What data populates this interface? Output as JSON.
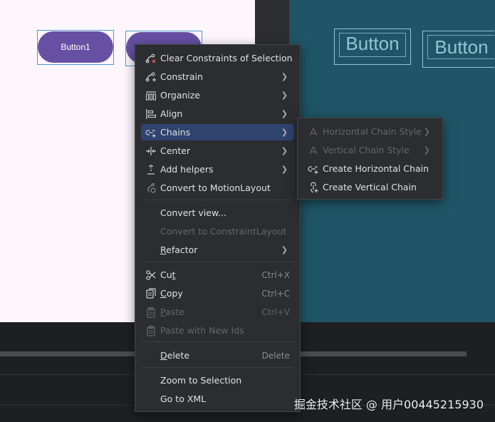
{
  "design": {
    "button1_label": "Button1",
    "blueprint_btn1": "Button",
    "blueprint_btn2": "Button"
  },
  "menu": {
    "items": [
      {
        "label": "Clear Constraints of Selection",
        "icon": "clear-constraints-icon"
      },
      {
        "label": "Constrain",
        "icon": "constrain-icon",
        "submenu": true
      },
      {
        "label": "Organize",
        "icon": "organize-icon",
        "submenu": true
      },
      {
        "label": "Align",
        "icon": "align-icon",
        "submenu": true
      },
      {
        "label": "Chains",
        "icon": "chain-icon",
        "submenu": true,
        "selected": true
      },
      {
        "label": "Center",
        "icon": "center-icon",
        "submenu": true
      },
      {
        "label": "Add helpers",
        "icon": "helpers-icon",
        "submenu": true
      },
      {
        "label": "Convert to MotionLayout",
        "icon": "motionlayout-icon"
      },
      {
        "label": "Convert view...",
        "icon": ""
      },
      {
        "label": "Convert to ConstraintLayout",
        "icon": "",
        "disabled": true
      },
      {
        "label": "Refactor",
        "icon": "",
        "submenu": true,
        "mnemonic": "R"
      },
      {
        "label": "Cut",
        "icon": "scissors-icon",
        "shortcut": "Ctrl+X",
        "mnemonic": "t"
      },
      {
        "label": "Copy",
        "icon": "copy-icon",
        "shortcut": "Ctrl+C",
        "mnemonic": "C"
      },
      {
        "label": "Paste",
        "icon": "paste-icon",
        "shortcut": "Ctrl+V",
        "disabled": true,
        "mnemonic": "P"
      },
      {
        "label": "Paste with New Ids",
        "icon": "paste-icon",
        "disabled": true
      },
      {
        "label": "Delete",
        "icon": "",
        "shortcut": "Delete",
        "mnemonic": "D"
      },
      {
        "label": "Zoom to Selection",
        "icon": ""
      },
      {
        "label": "Go to XML",
        "icon": ""
      }
    ]
  },
  "submenu": {
    "items": [
      {
        "label": "Horizontal Chain Style",
        "icon": "chain-style-icon",
        "submenu": true,
        "disabled": true
      },
      {
        "label": "Vertical Chain Style",
        "icon": "chain-style-icon",
        "submenu": true,
        "disabled": true
      },
      {
        "label": "Create Horizontal Chain",
        "icon": "horizontal-chain-icon"
      },
      {
        "label": "Create Vertical Chain",
        "icon": "vertical-chain-icon"
      }
    ]
  },
  "watermark": "掘金技术社区 @ 用户00445215930",
  "colors": {
    "accent": "#2e436e",
    "button_purple": "#6750a4",
    "blueprint_bg": "#1f5566",
    "menu_bg": "#2b2d30"
  }
}
